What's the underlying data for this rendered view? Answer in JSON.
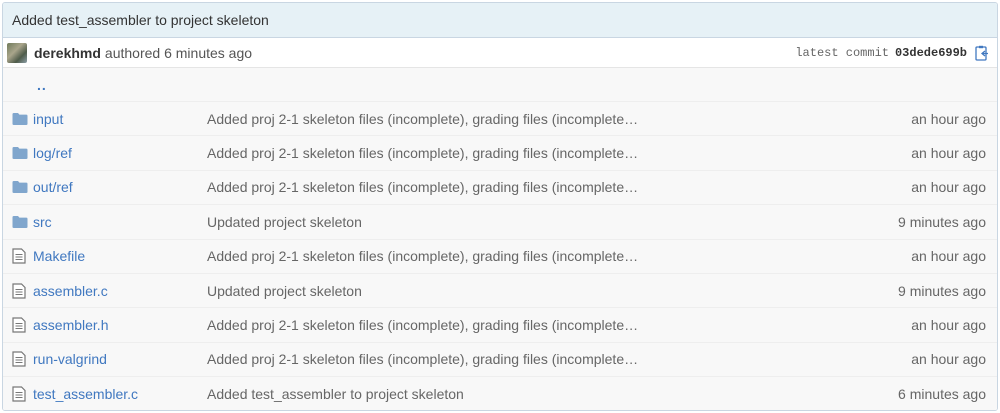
{
  "commit": {
    "title": "Added test_assembler to project skeleton",
    "author": "derekhmd",
    "authored_text": "authored 6 minutes ago",
    "latest_label": "latest commit",
    "sha": "03dede699b"
  },
  "parent_dir": "..",
  "files": [
    {
      "type": "folder",
      "name": "input",
      "message": "Added proj 2-1 skeleton files (incomplete), grading files (incomplete…",
      "age": "an hour ago"
    },
    {
      "type": "folder",
      "name": "log/ref",
      "message": "Added proj 2-1 skeleton files (incomplete), grading files (incomplete…",
      "age": "an hour ago"
    },
    {
      "type": "folder",
      "name": "out/ref",
      "message": "Added proj 2-1 skeleton files (incomplete), grading files (incomplete…",
      "age": "an hour ago"
    },
    {
      "type": "folder",
      "name": "src",
      "message": "Updated project skeleton",
      "age": "9 minutes ago"
    },
    {
      "type": "file",
      "name": "Makefile",
      "message": "Added proj 2-1 skeleton files (incomplete), grading files (incomplete…",
      "age": "an hour ago"
    },
    {
      "type": "file",
      "name": "assembler.c",
      "message": "Updated project skeleton",
      "age": "9 minutes ago"
    },
    {
      "type": "file",
      "name": "assembler.h",
      "message": "Added proj 2-1 skeleton files (incomplete), grading files (incomplete…",
      "age": "an hour ago"
    },
    {
      "type": "file",
      "name": "run-valgrind",
      "message": "Added proj 2-1 skeleton files (incomplete), grading files (incomplete…",
      "age": "an hour ago"
    },
    {
      "type": "file",
      "name": "test_assembler.c",
      "message": "Added test_assembler to project skeleton",
      "age": "6 minutes ago"
    }
  ],
  "colors": {
    "link": "#4078c0",
    "folder_icon": "#80a6cd",
    "header_bg": "#e6f1f6"
  }
}
